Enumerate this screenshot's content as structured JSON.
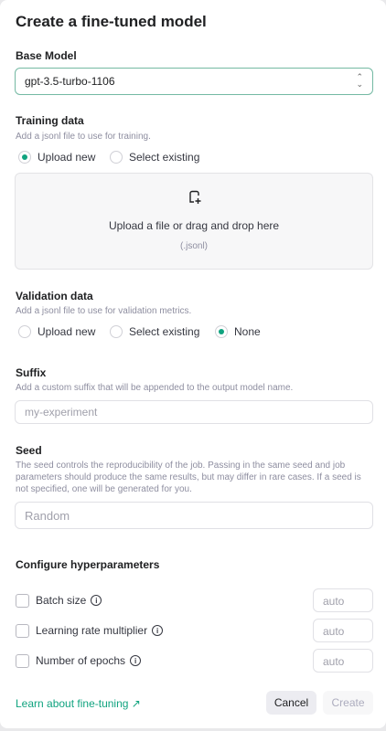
{
  "title": "Create a fine-tuned model",
  "base_model": {
    "label": "Base Model",
    "value": "gpt-3.5-turbo-1106"
  },
  "training": {
    "label": "Training data",
    "desc": "Add a jsonl file to use for training.",
    "options": [
      "Upload new",
      "Select existing"
    ],
    "selected": "Upload new",
    "drop_text": "Upload a file or drag and drop here",
    "drop_hint": "(.jsonl)"
  },
  "validation": {
    "label": "Validation data",
    "desc": "Add a jsonl file to use for validation metrics.",
    "options": [
      "Upload new",
      "Select existing",
      "None"
    ],
    "selected": "None"
  },
  "suffix": {
    "label": "Suffix",
    "desc": "Add a custom suffix that will be appended to the output model name.",
    "placeholder": "my-experiment"
  },
  "seed": {
    "label": "Seed",
    "desc": "The seed controls the reproducibility of the job. Passing in the same seed and job parameters should produce the same results, but may differ in rare cases. If a seed is not specified, one will be generated for you.",
    "placeholder": "Random"
  },
  "hyper": {
    "label": "Configure hyperparameters",
    "items": [
      {
        "label": "Batch size",
        "value": "auto"
      },
      {
        "label": "Learning rate multiplier",
        "value": "auto"
      },
      {
        "label": "Number of epochs",
        "value": "auto"
      }
    ]
  },
  "footer": {
    "link": "Learn about fine-tuning",
    "cancel": "Cancel",
    "create": "Create"
  },
  "colors": {
    "accent": "#10a37f"
  }
}
